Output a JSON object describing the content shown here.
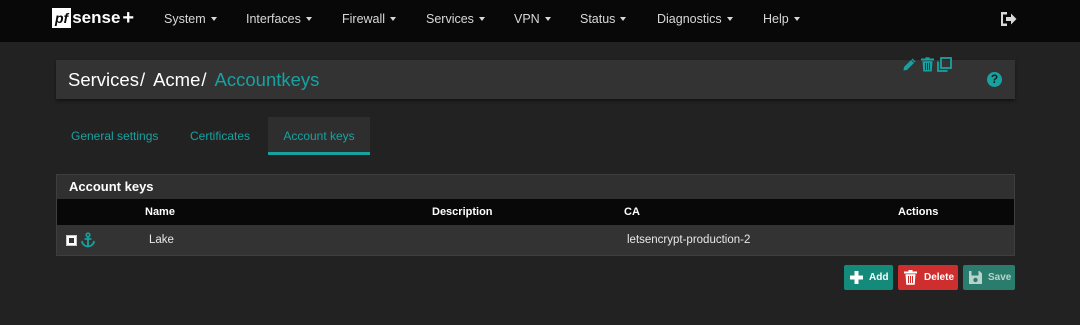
{
  "brand": {
    "pf": "pf",
    "sense": "sense",
    "plus": "+"
  },
  "nav": [
    {
      "label": "System"
    },
    {
      "label": "Interfaces"
    },
    {
      "label": "Firewall"
    },
    {
      "label": "Services"
    },
    {
      "label": "VPN"
    },
    {
      "label": "Status"
    },
    {
      "label": "Diagnostics"
    },
    {
      "label": "Help"
    }
  ],
  "nav_right_icon": "logout-icon",
  "breadcrumb": {
    "items": [
      "Services",
      "Acme"
    ],
    "separator": "/",
    "active": "Accountkeys"
  },
  "help_icon": "question-circle-icon",
  "tabs": [
    {
      "label": "General settings",
      "active": false
    },
    {
      "label": "Certificates",
      "active": false
    },
    {
      "label": "Account keys",
      "active": true
    }
  ],
  "panel": {
    "title": "Account keys",
    "columns": [
      "Name",
      "Description",
      "CA",
      "Actions"
    ],
    "rows": [
      {
        "name": "Lake",
        "description": "",
        "ca": "letsencrypt-production-2",
        "actions": [
          "edit-icon",
          "delete-icon",
          "copy-icon"
        ]
      }
    ]
  },
  "buttons": {
    "add": "Add",
    "delete": "Delete",
    "save": "Save"
  },
  "colors": {
    "accent": "#17a2a2",
    "navbar": "#080808",
    "background": "#222222",
    "add_button": "#148a7a",
    "delete_button": "#cf2e2e",
    "save_button": "#2a7d6d"
  }
}
